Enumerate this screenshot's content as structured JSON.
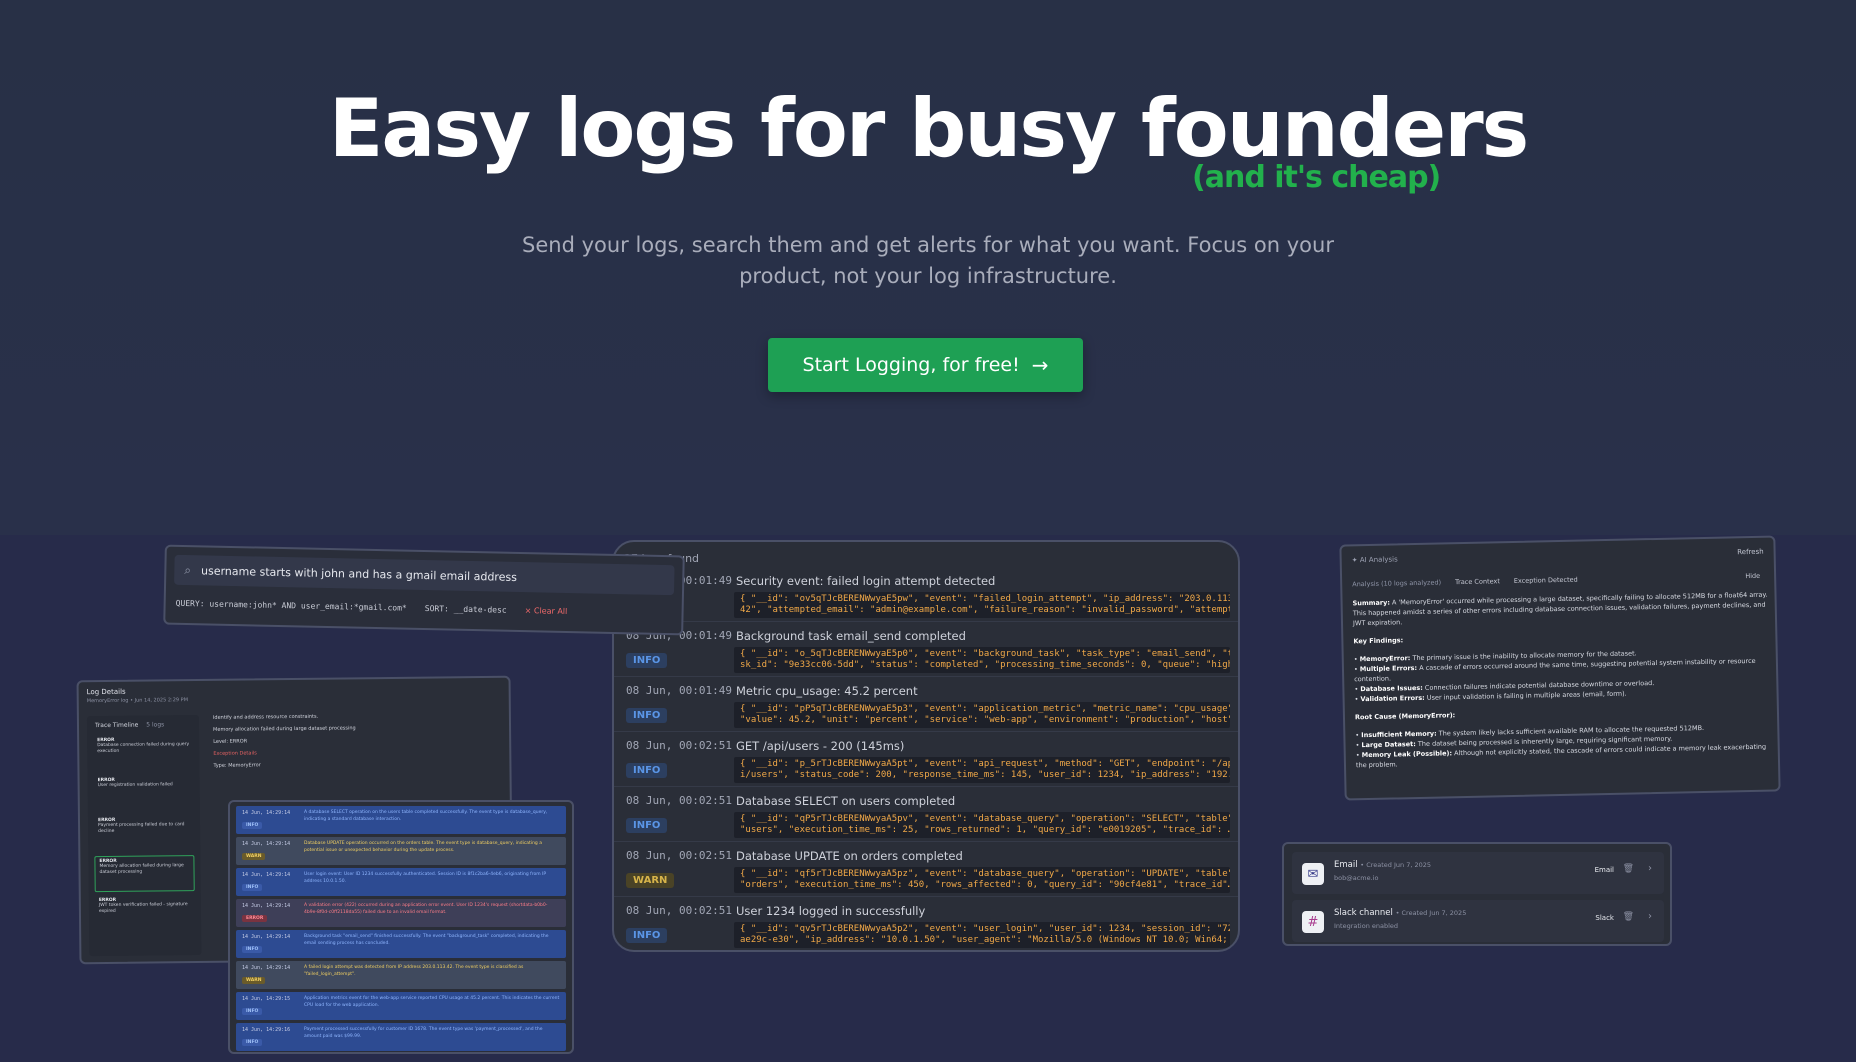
{
  "hero": {
    "headline": "Easy logs for busy founders",
    "subhead": "(and it's cheap)",
    "description": "Send your logs, search them and get alerts for what you want. Focus on your product, not your log infrastructure.",
    "cta_label": "Start Logging, for free!",
    "cta_arrow": "→"
  },
  "search": {
    "query_text": "username starts with john and has a gmail email address",
    "query_label": "QUERY: username:john* AND user_email:*gmail.com*",
    "sort_label": "SORT: __date-desc",
    "clear_label": "× Clear All"
  },
  "logs": {
    "count_label": "27  logs found",
    "rows": [
      {
        "time": "08 Jun, 00:01:49",
        "level": "",
        "title": "Security event: failed login attempt detected",
        "json1": "{ \"__id\": \"ov5qTJcBERENWwyaE5pw\", \"event\": \"failed_login_attempt\", \"ip_address\": \"203.0.113",
        "json2": "42\", \"attempted_email\": \"admin@example.com\", \"failure_reason\": \"invalid_password\", \"attempt…"
      },
      {
        "time": "08 Jun, 00:01:49",
        "level": "INFO",
        "title": "Background task email_send completed",
        "json1": "{ \"__id\": \"o_5qTJcBERENWwyaE5p0\", \"event\": \"background_task\", \"task_type\": \"email_send\", \"ta",
        "json2": "sk_id\": \"9e33cc06-5dd\", \"status\": \"completed\", \"processing_time_seconds\": 0, \"queue\": \"high…"
      },
      {
        "time": "08 Jun, 00:01:49",
        "level": "INFO",
        "title": "Metric cpu_usage: 45.2 percent",
        "json1": "{ \"__id\": \"pP5qTJcBERENWwyaE5p3\", \"event\": \"application_metric\", \"metric_name\": \"cpu_usage\",",
        "json2": "\"value\": 45.2, \"unit\": \"percent\", \"service\": \"web-app\", \"environment\": \"production\", \"host\"…"
      },
      {
        "time": "08 Jun, 00:02:51",
        "level": "INFO",
        "title": "GET /api/users - 200 (145ms)",
        "json1": "{ \"__id\": \"p_5rTJcBERENWwyaA5pt\", \"event\": \"api_request\", \"method\": \"GET\", \"endpoint\": \"/ap",
        "json2": "i/users\", \"status_code\": 200, \"response_time_ms\": 145, \"user_id\": 1234, \"ip_address\": \"192.…"
      },
      {
        "time": "08 Jun, 00:02:51",
        "level": "INFO",
        "title": "Database SELECT on users completed",
        "json1": "{ \"__id\": \"qP5rTJcBERENWwyaA5pv\", \"event\": \"database_query\", \"operation\": \"SELECT\", \"table\"",
        "json2": "\"users\", \"execution_time_ms\": 25, \"rows_returned\": 1, \"query_id\": \"e0019205\", \"trace_id\": …"
      },
      {
        "time": "08 Jun, 00:02:51",
        "level": "WARN",
        "title": "Database UPDATE on orders completed",
        "json1": "{ \"__id\": \"qf5rTJcBERENWwyaA5pz\", \"event\": \"database_query\", \"operation\": \"UPDATE\", \"table\"",
        "json2": "\"orders\", \"execution_time_ms\": 450, \"rows_affected\": 0, \"query_id\": \"90cf4e81\", \"trace_id\"…"
      },
      {
        "time": "08 Jun, 00:02:51",
        "level": "INFO",
        "title": "User 1234 logged in successfully",
        "json1": "{ \"__id\": \"qv5rTJcBERENWwyaA5p2\", \"event\": \"user_login\", \"user_id\": 1234, \"session_id\": \"721",
        "json2": "ae29c-e30\", \"ip_address\": \"10.0.1.50\", \"user_agent\": \"Mozilla/5.0 (Windows NT 10.0; Win64; …"
      }
    ]
  },
  "ai": {
    "header": "AI Analysis",
    "refresh": "Refresh",
    "tabs": [
      "Analysis (10 logs analyzed)",
      "Trace Context",
      "Exception Detected"
    ],
    "hide": "Hide",
    "summary_label": "Summary:",
    "summary": "A 'MemoryError' occurred while processing a large dataset, specifically failing to allocate 512MB for a float64 array. This happened amidst a series of other errors including database connection issues, validation failures, payment declines, and JWT expiration.",
    "key_findings_title": "Key Findings:",
    "findings": [
      {
        "label": "MemoryError:",
        "text": "The primary issue is the inability to allocate memory for the dataset."
      },
      {
        "label": "Multiple Errors:",
        "text": "A cascade of errors occurred around the same time, suggesting potential system instability or resource contention."
      },
      {
        "label": "Database Issues:",
        "text": "Connection failures indicate potential database downtime or overload."
      },
      {
        "label": "Validation Errors:",
        "text": "User input validation is failing in multiple areas (email, form)."
      }
    ],
    "root_cause_title": "Root Cause (MemoryError):",
    "causes": [
      {
        "label": "Insufficient Memory:",
        "text": "The system likely lacks sufficient available RAM to allocate the requested 512MB."
      },
      {
        "label": "Large Dataset:",
        "text": "The dataset being processed is inherently large, requiring significant memory."
      },
      {
        "label": "Memory Leak (Possible):",
        "text": "Although not explicitly stated, the cascade of errors could indicate a memory leak exacerbating the problem."
      }
    ]
  },
  "integrations": [
    {
      "name": "Email",
      "created": "• Created Jun 7, 2025",
      "sub": "bob@acme.io",
      "type": "Email",
      "icon": "✉"
    },
    {
      "name": "Slack channel",
      "created": "• Created Jun 7, 2025",
      "sub": "Integration enabled",
      "type": "Slack",
      "icon": "#"
    }
  ],
  "details": {
    "title": "Log Details",
    "meta": "MemoryError log  •  Jun 14, 2025 2:29 PM",
    "timeline_title": "Trace Timeline",
    "timeline_count": "5 logs",
    "items": [
      {
        "level": "ERROR",
        "text": "Database connection failed during query execution"
      },
      {
        "level": "ERROR",
        "text": "User registration validation failed"
      },
      {
        "level": "ERROR",
        "text": "Payment processing failed due to card decline"
      },
      {
        "level": "ERROR",
        "text": "Memory allocation failed during large dataset processing"
      },
      {
        "level": "ERROR",
        "text": "JWT token verification failed - signature expired"
      }
    ],
    "lines": [
      "Identify and address resource constraints.",
      "Memory allocation failed during large dataset processing",
      "Level: ERROR",
      "Exception Details",
      "Type: MemoryError"
    ]
  },
  "stack": [
    {
      "time": "14 Jun, 14:29:14",
      "level": "INFO",
      "text": "A database SELECT operation on the users table completed successfully. The event type is database_query, indicating a standard database interaction."
    },
    {
      "time": "14 Jun, 14:29:14",
      "level": "WARN",
      "text": "Database UPDATE operation occurred on the orders table. The event type is database_query, indicating a potential issue or unexpected behavior during the update process."
    },
    {
      "time": "14 Jun, 14:29:14",
      "level": "INFO",
      "text": "User login event: User ID 1234 successfully authenticated. Session ID is 8f1c2ba6-4eb6, originating from IP address 10.0.1.50."
    },
    {
      "time": "14 Jun, 14:29:14",
      "level": "ERROR",
      "text": "A validation error (422) occurred during an application error event. User ID 1234's request (shortdata-b0b0-4b9e-8f0d-c0ff2118da55) failed due to an invalid email format."
    },
    {
      "time": "14 Jun, 14:29:14",
      "level": "INFO",
      "text": "Background task \"email_send\" finished successfully. The event \"background_task\" completed, indicating the email sending process has concluded."
    },
    {
      "time": "14 Jun, 14:29:14",
      "level": "WARN",
      "text": "A failed login attempt was detected from IP address 203.0.113.42. The event type is classified as \"failed_login_attempt\"."
    },
    {
      "time": "14 Jun, 14:29:15",
      "level": "INFO",
      "text": "Application metrics event for the web-app service reported CPU usage at 45.2 percent. This indicates the current CPU load for the web application."
    },
    {
      "time": "14 Jun, 14:29:16",
      "level": "INFO",
      "text": "Payment processed successfully for customer ID 1678. The event type was 'payment_processed', and the amount paid was $99.99."
    }
  ]
}
